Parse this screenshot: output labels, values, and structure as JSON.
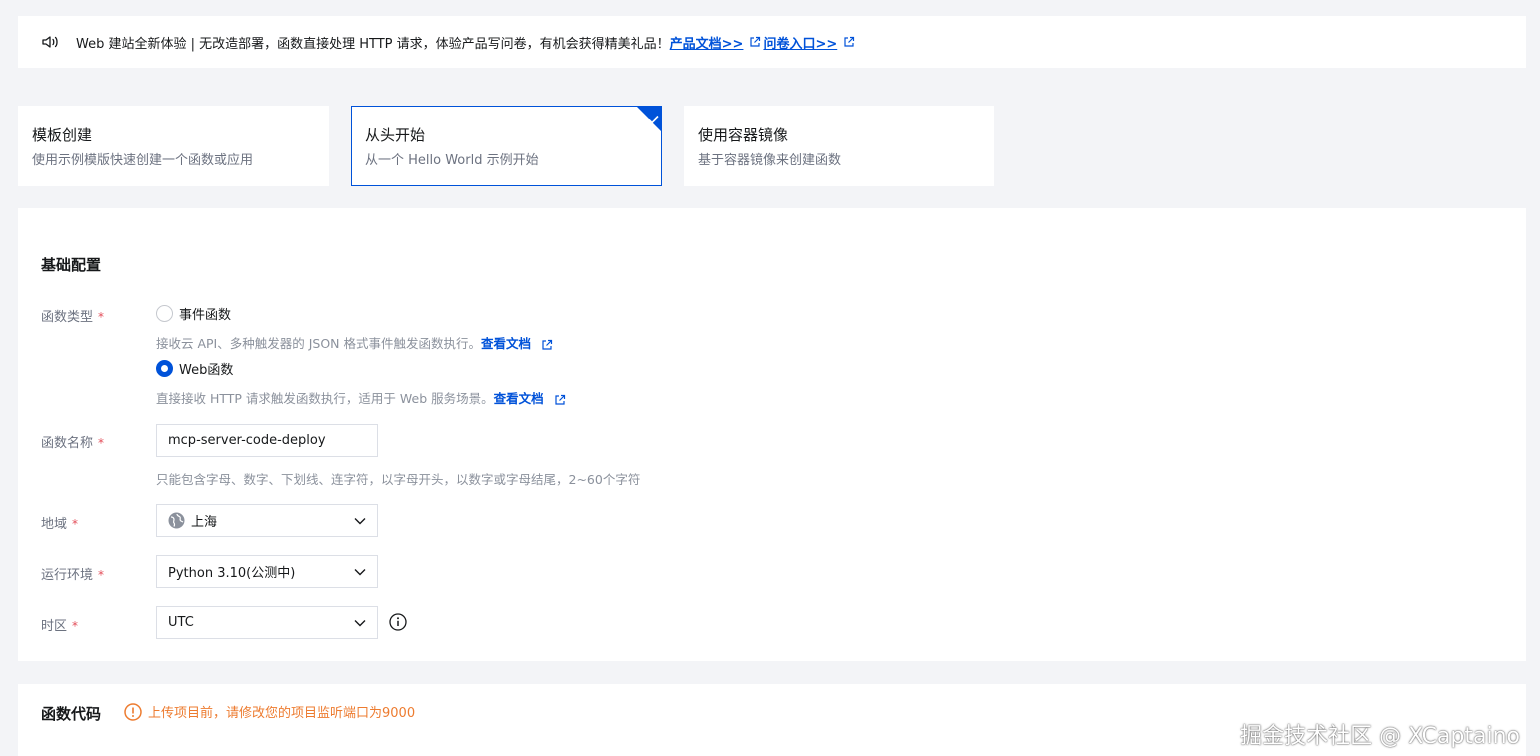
{
  "notice": {
    "text": "Web 建站全新体验 | 无改造部署，函数直接处理 HTTP 请求，体验产品写问卷，有机会获得精美礼品！",
    "link1": "产品文档>>",
    "link2": "问卷入口>>",
    "icon": "speaker-icon"
  },
  "creation_methods": [
    {
      "title": "模板创建",
      "desc": "使用示例模版快速创建一个函数或应用",
      "selected": false
    },
    {
      "title": "从头开始",
      "desc": "从一个 Hello World 示例开始",
      "selected": true
    },
    {
      "title": "使用容器镜像",
      "desc": "基于容器镜像来创建函数",
      "selected": false
    }
  ],
  "basic_config": {
    "heading": "基础配置",
    "required_mark": "*",
    "function_type": {
      "label": "函数类型",
      "options": [
        {
          "label": "事件函数",
          "hint": "接收云 API、多种触发器的 JSON 格式事件触发函数执行。",
          "doc_link": "查看文档",
          "checked": false
        },
        {
          "label": "Web函数",
          "hint": "直接接收 HTTP 请求触发函数执行，适用于 Web 服务场景。",
          "doc_link": "查看文档",
          "checked": true
        }
      ]
    },
    "function_name": {
      "label": "函数名称",
      "value": "mcp-server-code-deploy",
      "hint": "只能包含字母、数字、下划线、连字符，以字母开头，以数字或字母结尾，2~60个字符"
    },
    "region": {
      "label": "地域",
      "value": "上海"
    },
    "runtime": {
      "label": "运行环境",
      "value": "Python 3.10(公测中)"
    },
    "timezone": {
      "label": "时区",
      "value": "UTC"
    }
  },
  "function_code": {
    "heading": "函数代码",
    "warning": "上传项目前，请修改您的项目监听端口为9000"
  },
  "watermark": "掘金技术社区 @ XCaptaino",
  "colors": {
    "accent": "#0052d9",
    "required": "#e34d59",
    "warning": "#ed7b2f",
    "background": "#f3f4f7"
  }
}
